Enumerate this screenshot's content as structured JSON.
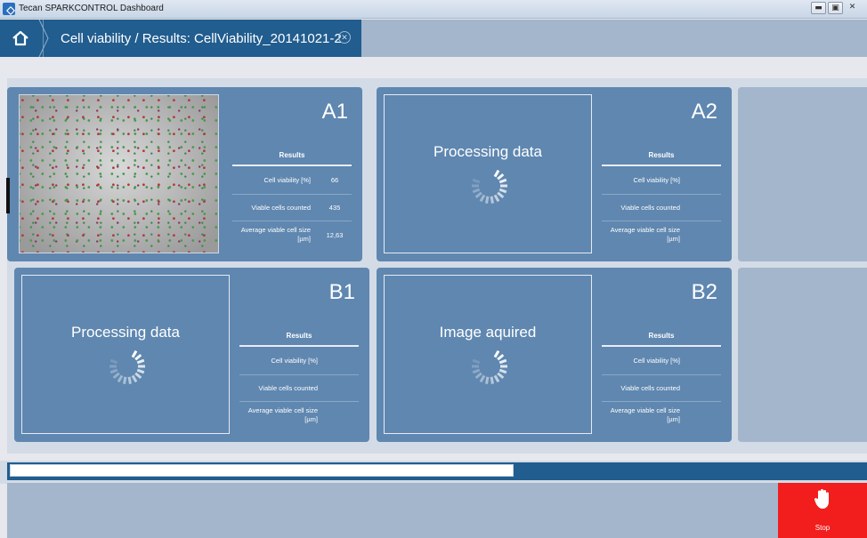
{
  "window": {
    "title": "Tecan SPARKCONTROL Dashboard",
    "controls": [
      "minimize",
      "maximize",
      "close"
    ]
  },
  "nav": {
    "home_icon": "home-icon",
    "breadcrumb": "Cell viability / Results: CellViability_20141021-2",
    "close_icon": "close-circle-icon"
  },
  "results_labels": {
    "heading": "Results",
    "cell_viability": "Cell viability [%]",
    "viable_cells": "Viable cells counted",
    "avg_size": "Average viable cell size [µm]"
  },
  "wells": {
    "A1": {
      "id": "A1",
      "status": "",
      "cell_viability": "66",
      "viable_cells": "435",
      "avg_size": "12,63"
    },
    "A2": {
      "id": "A2",
      "status": "Processing data",
      "cell_viability": "",
      "viable_cells": "",
      "avg_size": ""
    },
    "B1": {
      "id": "B1",
      "status": "Processing data",
      "cell_viability": "",
      "viable_cells": "",
      "avg_size": ""
    },
    "B2": {
      "id": "B2",
      "status": "Image aquired",
      "cell_viability": "",
      "viable_cells": "",
      "avg_size": ""
    }
  },
  "progress": {
    "fraction": 0.59
  },
  "footer": {
    "stop_label": "Stop",
    "stop_icon": "hand-stop-icon"
  },
  "colors": {
    "accent": "#215d8f",
    "tile": "#5f87b0",
    "stop": "#f21d1d"
  }
}
